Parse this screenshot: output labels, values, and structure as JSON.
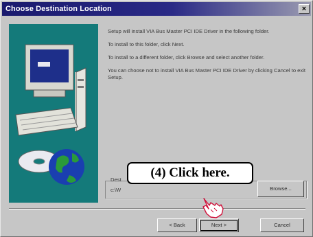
{
  "window": {
    "title": "Choose Destination Location",
    "close_glyph": "×"
  },
  "body": {
    "paragraphs": [
      "Setup will install VIA Bus Master PCI IDE Driver in the following folder.",
      "To install to this folder, click Next.",
      "To install to a different folder, click Browse and select another folder.",
      "You can choose not to install VIA Bus Master PCI IDE Driver by clicking Cancel to exit Setup."
    ],
    "destination_label": "Dest",
    "destination_path": "c:\\W"
  },
  "buttons": {
    "browse": "Browse...",
    "back": "< Back",
    "next": "Next >",
    "cancel": "Cancel"
  },
  "callout": {
    "text": "(4)  Click here."
  },
  "icons": {
    "pointer": "hand-pointer-icon",
    "illustration": "computer-with-cd-and-globe"
  },
  "colors": {
    "titlebar_start": "#1a1a6e",
    "art_background": "#147a7a",
    "dialog_background": "#c6c6c6"
  }
}
